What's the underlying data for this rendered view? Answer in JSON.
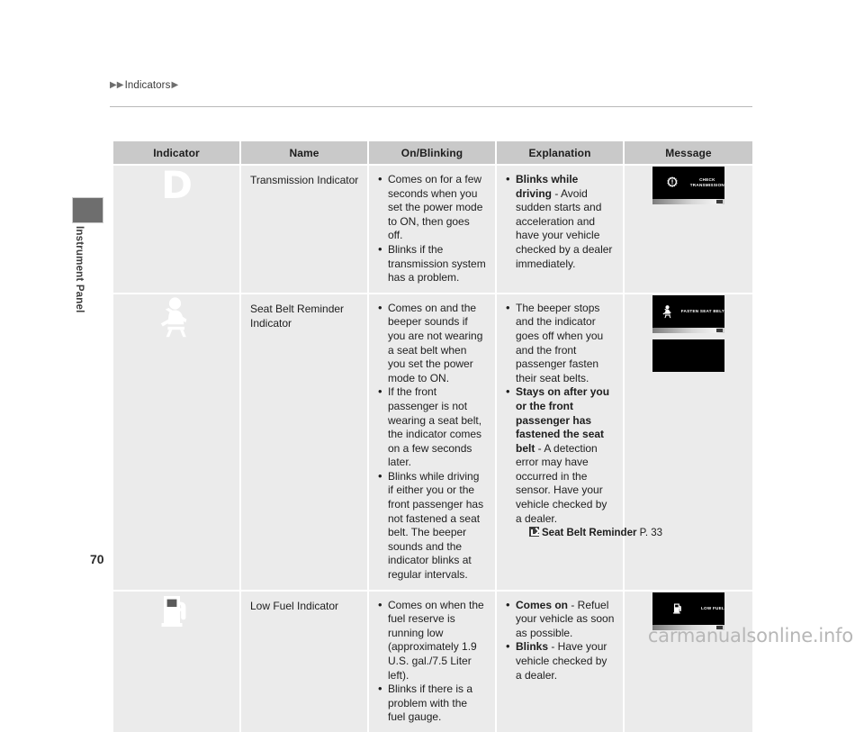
{
  "breadcrumb": {
    "marker1": "▶",
    "marker2": "▶",
    "text": "Indicators",
    "marker3": "▶"
  },
  "sidebar": {
    "chapter_label": "Instrument Panel"
  },
  "page": {
    "number": "70",
    "watermark": "carmanualsonline.info"
  },
  "table": {
    "headers": [
      "Indicator",
      "Name",
      "On/Blinking",
      "Explanation",
      "Message"
    ],
    "rows": [
      {
        "indicator_icon": "transmission-d-indicator-icon",
        "indicator_glyph": "D",
        "name": "Transmission Indicator",
        "on_blinking": [
          {
            "bold": "",
            "text": "Comes on for a few seconds when you set the power mode to ON, then goes off."
          },
          {
            "bold": "",
            "text": "Blinks if the transmission system has a problem."
          }
        ],
        "explanation": [
          {
            "bold": "Blinks while driving",
            "text": " - Avoid sudden starts and acceleration and have your vehicle checked by a dealer immediately."
          }
        ],
        "reference": null,
        "messages": [
          {
            "icon": "gear-exclamation-icon",
            "lines": [
              "CHECK",
              "TRANSMISSION"
            ],
            "blank": false
          }
        ]
      },
      {
        "indicator_icon": "seat-belt-reminder-icon",
        "indicator_glyph": "",
        "name": "Seat Belt Reminder Indicator",
        "on_blinking": [
          {
            "bold": "",
            "text": "Comes on and the beeper sounds if you are not wearing a seat belt when you set the power mode to ON."
          },
          {
            "bold": "",
            "text": "If the front passenger is not wearing a seat belt, the indicator comes on a few seconds later."
          },
          {
            "bold": "",
            "text": "Blinks while driving if either you or the front passenger has not fastened a seat belt. The beeper sounds and the indicator blinks at regular intervals."
          }
        ],
        "explanation": [
          {
            "bold": "",
            "text": "The beeper stops and the indicator goes off when you and the front passenger fasten their seat belts."
          },
          {
            "bold": "Stays on after you or the front passenger has fastened the seat belt",
            "text": " - A detection error may have occurred in the sensor. Have your vehicle checked by a dealer."
          }
        ],
        "reference": {
          "title": "Seat Belt Reminder",
          "page": "P. 33"
        },
        "messages": [
          {
            "icon": "seat-belt-icon",
            "lines": [
              "FASTEN SEAT BELT"
            ],
            "blank": false
          },
          {
            "icon": "",
            "lines": [],
            "blank": true
          }
        ]
      },
      {
        "indicator_icon": "low-fuel-pump-icon",
        "indicator_glyph": "",
        "name": "Low Fuel Indicator",
        "on_blinking": [
          {
            "bold": "",
            "text": "Comes on when the fuel reserve is running low (approximately 1.9 U.S. gal./7.5 Liter left)."
          },
          {
            "bold": "",
            "text": "Blinks if there is a problem with the fuel gauge."
          }
        ],
        "explanation": [
          {
            "bold": "Comes on",
            "text": " - Refuel your vehicle as soon as possible."
          },
          {
            "bold": "Blinks",
            "text": " - Have your vehicle checked by a dealer."
          }
        ],
        "reference": null,
        "messages": [
          {
            "icon": "fuel-pump-icon",
            "lines": [
              "LOW FUEL"
            ],
            "blank": false
          }
        ]
      }
    ]
  },
  "colors": {
    "header_bg": "#c9c9c9",
    "cell_bg": "#ebebeb",
    "indicator_bg": "#5a5a5a",
    "message_bg": "#7a7a7a",
    "screen_bg": "#000000",
    "text": "#1d1d1d"
  }
}
